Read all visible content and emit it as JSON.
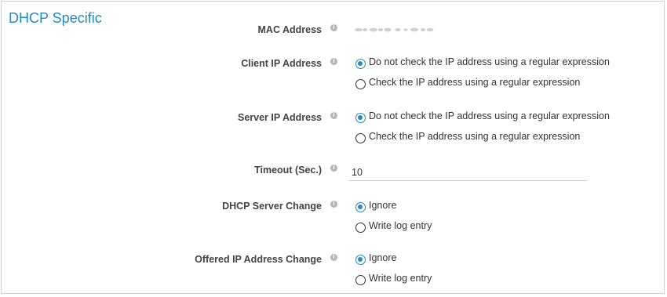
{
  "section": {
    "title": "DHCP Specific"
  },
  "fields": {
    "mac": {
      "label": "MAC Address"
    },
    "client_ip": {
      "label": "Client IP Address",
      "options": [
        "Do not check the IP address using a regular expression",
        "Check the IP address using a regular expression"
      ],
      "selected_index": 0
    },
    "server_ip": {
      "label": "Server IP Address",
      "options": [
        "Do not check the IP address using a regular expression",
        "Check the IP address using a regular expression"
      ],
      "selected_index": 0
    },
    "timeout": {
      "label": "Timeout (Sec.)",
      "value": "10"
    },
    "dhcp_server_change": {
      "label": "DHCP Server Change",
      "options": [
        "Ignore",
        "Write log entry"
      ],
      "selected_index": 0
    },
    "offered_ip_change": {
      "label": "Offered IP Address Change",
      "options": [
        "Ignore",
        "Write log entry"
      ],
      "selected_index": 0
    }
  },
  "icons": {
    "info": "info-icon",
    "radio_on": "radio-selected",
    "radio_off": "radio-unselected"
  },
  "colors": {
    "accent": "#1f8bc7",
    "label": "#444444",
    "border": "#d0d0d0",
    "info_icon": "#b5b5b5"
  }
}
